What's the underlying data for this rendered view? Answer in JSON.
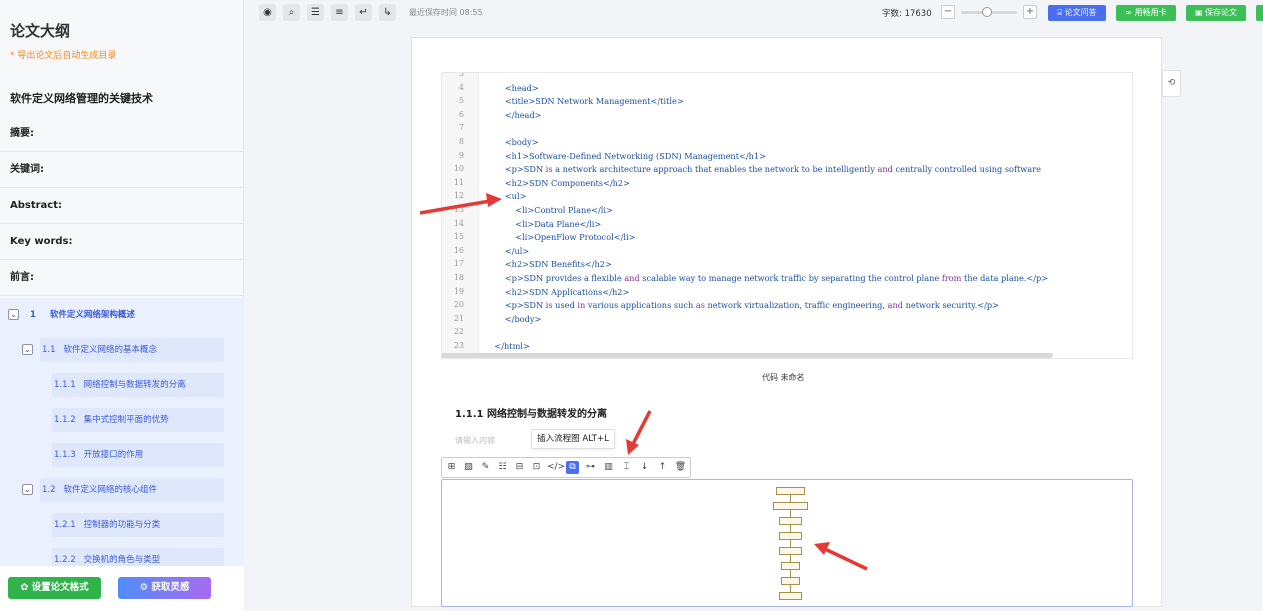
{
  "sidebar": {
    "title": "论文大纲",
    "note": "* 导出论文后自动生成目录",
    "paper_title": "软件定义网络管理的关键技术",
    "sections": [
      "摘要:",
      "关键词:",
      "Abstract:",
      "Key words:",
      "前言:"
    ],
    "outline": [
      {
        "num": "1",
        "label": "软件定义网络架构概述"
      },
      {
        "num": "1.1",
        "label": "软件定义网络的基本概念"
      },
      {
        "num": "1.1.1",
        "label": "网络控制与数据转发的分离"
      },
      {
        "num": "1.1.2",
        "label": "集中式控制平面的优势"
      },
      {
        "num": "1.1.3",
        "label": "开放接口的作用"
      },
      {
        "num": "1.2",
        "label": "软件定义网络的核心组件"
      },
      {
        "num": "1.2.1",
        "label": "控制器的功能与分类"
      },
      {
        "num": "1.2.2",
        "label": "交换机的角色与类型"
      }
    ],
    "btn_format": "设置论文格式",
    "btn_inspire": "获取灵感"
  },
  "toolbar": {
    "save_time": "最近保存时间 08:55",
    "word_count": "字数: 17630",
    "btn_qa": "论文问答",
    "btn_card": "用畅用卡",
    "btn_save": "保存论文"
  },
  "code_lines": [
    {
      "n": "3",
      "t": ""
    },
    {
      "n": "4",
      "t": "        <head>"
    },
    {
      "n": "5",
      "t": "        <title>SDN Network Management</title>"
    },
    {
      "n": "6",
      "t": "        </head>"
    },
    {
      "n": "7",
      "t": ""
    },
    {
      "n": "8",
      "t": "        <body>"
    },
    {
      "n": "9",
      "t": "        <h1>Software-Defined Networking (SDN) Management</h1>"
    },
    {
      "n": "10",
      "t": "        <p>SDN is a network architecture approach that enables the network to be intelligently and centrally controlled using software"
    },
    {
      "n": "11",
      "t": "        <h2>SDN Components</h2>"
    },
    {
      "n": "12",
      "t": "        <ul>"
    },
    {
      "n": "13",
      "t": "            <li>Control Plane</li>"
    },
    {
      "n": "14",
      "t": "            <li>Data Plane</li>"
    },
    {
      "n": "15",
      "t": "            <li>OpenFlow Protocol</li>"
    },
    {
      "n": "16",
      "t": "        </ul>"
    },
    {
      "n": "17",
      "t": "        <h2>SDN Benefits</h2>"
    },
    {
      "n": "18",
      "t": "        <p>SDN provides a flexible and scalable way to manage network traffic by separating the control plane from the data plane.</p>"
    },
    {
      "n": "19",
      "t": "        <h2>SDN Applications</h2>"
    },
    {
      "n": "20",
      "t": "        <p>SDN is used in various applications such as network virtualization, traffic engineering, and network security.</p>"
    },
    {
      "n": "21",
      "t": "        </body>"
    },
    {
      "n": "22",
      "t": ""
    },
    {
      "n": "23",
      "t": "    </html>"
    }
  ],
  "doc": {
    "caption": "代码   未命名",
    "heading": "1.1.1 网络控制与数据转发的分离",
    "placeholder": "请输入内容",
    "tooltip": "插入流程图 ALT+L"
  }
}
